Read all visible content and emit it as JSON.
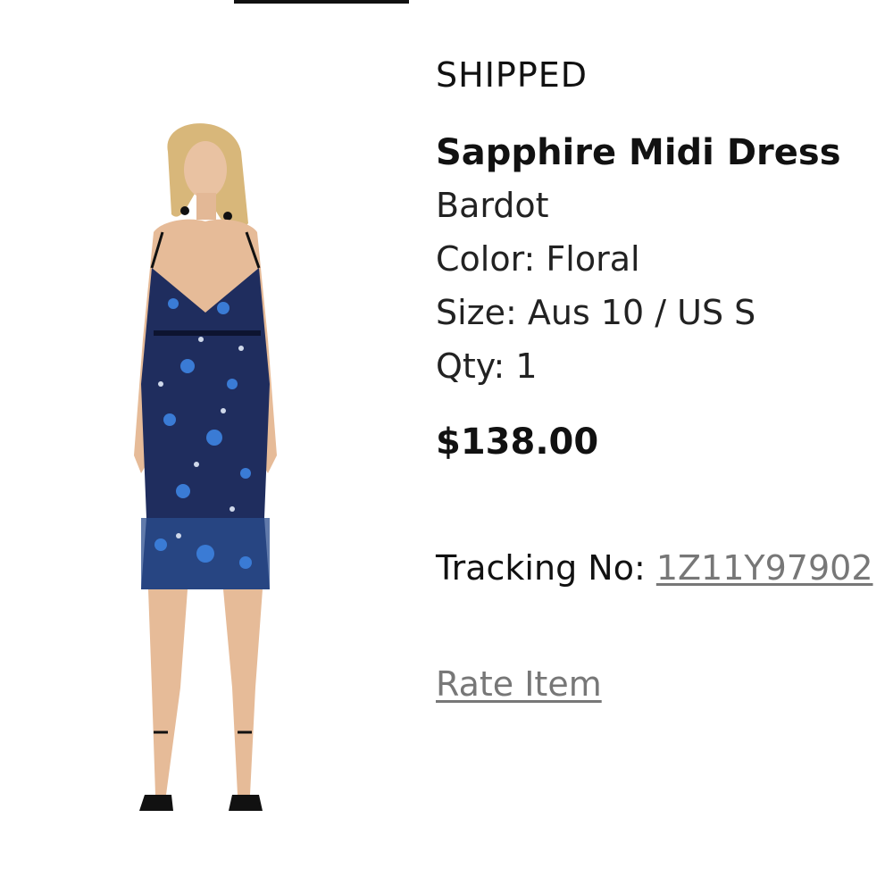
{
  "order_item": {
    "status": "SHIPPED",
    "product_name": "Sapphire Midi Dress",
    "brand": "Bardot",
    "color_text": "Color: Floral",
    "size_text": "Size: Aus 10 / US S",
    "qty_text": "Qty: 1",
    "price": "$138.00",
    "tracking_label": "Tracking No: ",
    "tracking_number": "1Z11Y97902",
    "rate_label": "Rate Item"
  },
  "colors": {
    "text": "#111111",
    "link": "#777777",
    "dress_navy": "#1f2d5e",
    "dress_blue": "#3a7bd5"
  }
}
